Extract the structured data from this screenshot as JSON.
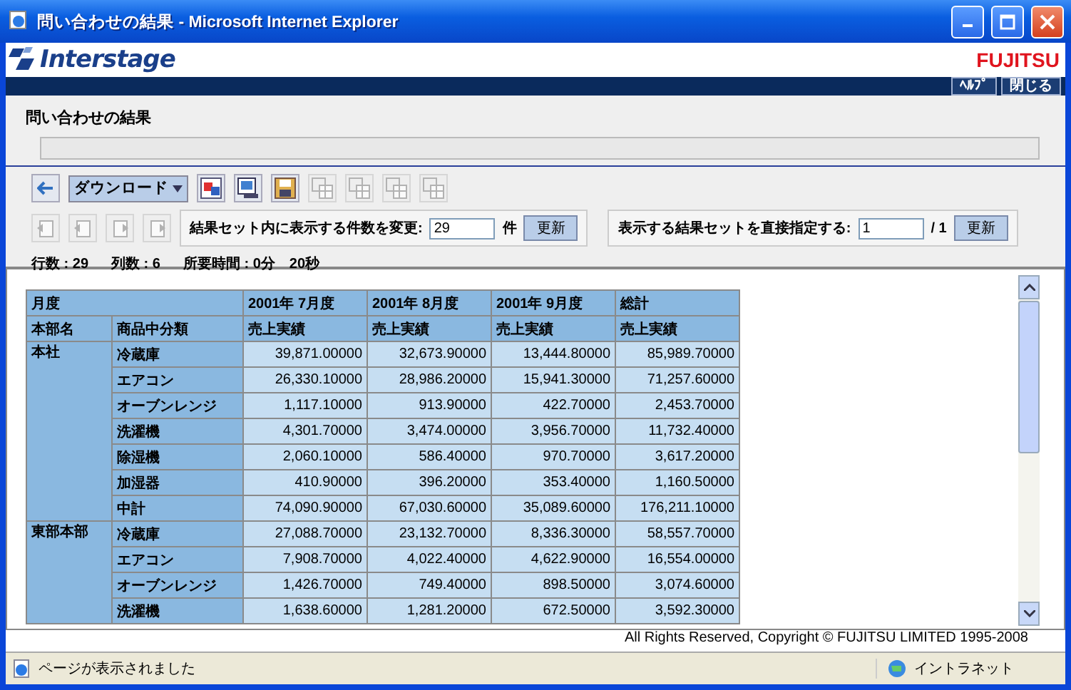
{
  "window": {
    "title": "問い合わせの結果 - Microsoft Internet Explorer"
  },
  "header": {
    "logo": "Interstage",
    "brand": "FUJITSU",
    "links": [
      "ﾍﾙﾌﾟ",
      "閉じる"
    ]
  },
  "page_title": "問い合わせの結果",
  "toolbar": {
    "download": "ダウンロード",
    "icons": [
      {
        "kind": "export",
        "disabled": false
      },
      {
        "kind": "preview",
        "disabled": false
      },
      {
        "kind": "save",
        "disabled": false
      },
      {
        "kind": "grid",
        "disabled": true
      },
      {
        "kind": "grid",
        "disabled": true
      },
      {
        "kind": "grid",
        "disabled": true
      },
      {
        "kind": "grid",
        "disabled": true
      }
    ]
  },
  "nav_buttons": [
    {
      "disabled": true
    },
    {
      "disabled": true
    },
    {
      "disabled": true
    },
    {
      "disabled": true
    }
  ],
  "rows_form": {
    "label": "結果セット内に表示する件数を変更:",
    "value": "29",
    "unit": "件",
    "button": "更新"
  },
  "set_form": {
    "label": "表示する結果セットを直接指定する:",
    "value": "1",
    "total": "/ 1",
    "button": "更新"
  },
  "stats": [
    "行数 : 29",
    "列数 : 6",
    "所要時間 : 0分　20秒"
  ],
  "table": {
    "header_rows": [
      [
        "月度",
        "2001年 7月度",
        "2001年 8月度",
        "2001年 9月度",
        "総計"
      ],
      [
        "本部名",
        "商品中分類",
        "売上実績",
        "売上実績",
        "売上実績",
        "売上実績"
      ]
    ],
    "groups": [
      {
        "division": "本社",
        "rows": [
          {
            "category": "冷蔵庫",
            "values": [
              "39,871.00000",
              "32,673.90000",
              "13,444.80000",
              "85,989.70000"
            ]
          },
          {
            "category": "エアコン",
            "values": [
              "26,330.10000",
              "28,986.20000",
              "15,941.30000",
              "71,257.60000"
            ]
          },
          {
            "category": "オーブンレンジ",
            "values": [
              "1,117.10000",
              "913.90000",
              "422.70000",
              "2,453.70000"
            ]
          },
          {
            "category": "洗濯機",
            "values": [
              "4,301.70000",
              "3,474.00000",
              "3,956.70000",
              "11,732.40000"
            ]
          },
          {
            "category": "除湿機",
            "values": [
              "2,060.10000",
              "586.40000",
              "970.70000",
              "3,617.20000"
            ]
          },
          {
            "category": "加湿器",
            "values": [
              "410.90000",
              "396.20000",
              "353.40000",
              "1,160.50000"
            ]
          },
          {
            "category": "中計",
            "values": [
              "74,090.90000",
              "67,030.60000",
              "35,089.60000",
              "176,211.10000"
            ]
          }
        ]
      },
      {
        "division": "東部本部",
        "rows": [
          {
            "category": "冷蔵庫",
            "values": [
              "27,088.70000",
              "23,132.70000",
              "8,336.30000",
              "58,557.70000"
            ]
          },
          {
            "category": "エアコン",
            "values": [
              "7,908.70000",
              "4,022.40000",
              "4,622.90000",
              "16,554.00000"
            ]
          },
          {
            "category": "オーブンレンジ",
            "values": [
              "1,426.70000",
              "749.40000",
              "898.50000",
              "3,074.60000"
            ]
          },
          {
            "category": "洗濯機",
            "values": [
              "1,638.60000",
              "1,281.20000",
              "672.50000",
              "3,592.30000"
            ]
          }
        ]
      }
    ]
  },
  "copyright": "All Rights Reserved, Copyright © FUJITSU LIMITED 1995-2008",
  "status_bar": {
    "message": "ページが表示されました",
    "zone": "イントラネット"
  }
}
